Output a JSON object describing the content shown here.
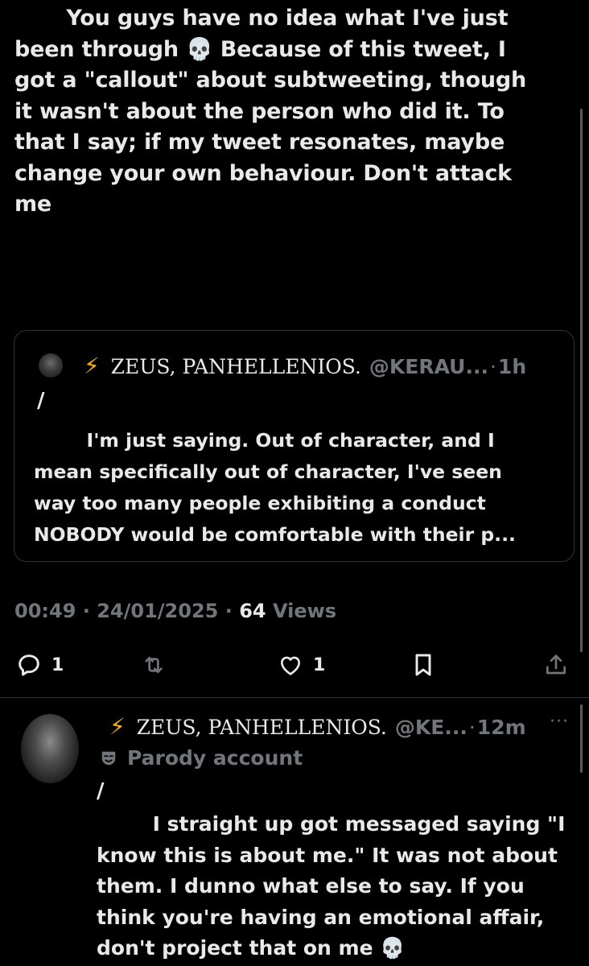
{
  "main_tweet": {
    "text": "       You guys have no idea what I've just\nbeen through 💀 Because of this tweet, I\ngot a \"callout\" about subtweeting, though\nit wasn't about the person who did it. To\nthat I say; if my tweet resonates, maybe\nchange your own behaviour. Don't attack\nme",
    "timestamp": "00:49 · 24/01/2025 · ",
    "views_count": "64",
    "views_label": " Views"
  },
  "quote": {
    "bolt": "⚡",
    "name": "ZEUS, PANHELLENIOS.",
    "handle": "@KERAU...",
    "separator": "·",
    "time": "1h",
    "slash": "/",
    "text": "        I'm just saying. Out of character, and I\nmean specifically out of character, I've seen\nway too many people exhibiting a conduct\nNOBODY would be comfortable with their p..."
  },
  "actions": {
    "reply_count": "1",
    "like_count": "1",
    "icons": [
      "reply-icon",
      "retweet-icon",
      "like-icon",
      "bookmark-icon",
      "share-icon"
    ]
  },
  "reply": {
    "bolt": "⚡",
    "name": "ZEUS, PANHELLENIOS.",
    "handle": "@KE...",
    "separator": "·",
    "time": "12m",
    "more": "···",
    "parody_label": "Parody account",
    "slash": "/",
    "text": "        I straight up got messaged saying \"I\nknow this is about me.\" It was not about\nthem. I dunno what else to say. If you\nthink you're having an emotional affair,\ndon't project that on me 💀"
  },
  "colors": {
    "background": "#000000",
    "text": "#e7e9ea",
    "secondary": "#71767b",
    "border": "#2f3336",
    "bolt": "#f4b400"
  }
}
